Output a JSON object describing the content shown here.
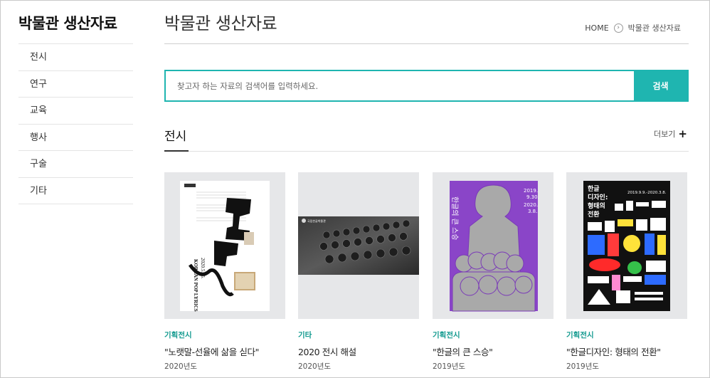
{
  "sidebar": {
    "title": "박물관 생산자료",
    "items": [
      {
        "label": "전시"
      },
      {
        "label": "연구"
      },
      {
        "label": "교육"
      },
      {
        "label": "행사"
      },
      {
        "label": "구술"
      },
      {
        "label": "기타"
      }
    ]
  },
  "header": {
    "title": "박물관 생산자료",
    "breadcrumb": {
      "home": "HOME",
      "current": "박물관 생산자료"
    }
  },
  "search": {
    "placeholder": "찾고자 하는 자료의 검색어를 입력하세요.",
    "value": "",
    "button_label": "검색"
  },
  "section": {
    "title": "전시",
    "more_label": "더보기",
    "more_icon": "plus-icon"
  },
  "cards": [
    {
      "category": "기획전시",
      "title": "\"노랫말-선율에 삶을 싣다\"",
      "year": "2020년도",
      "thumb_texts": [
        "KOREAN POP LYRICS",
        "2020.5.15."
      ]
    },
    {
      "category": "기타",
      "title": "2020 전시 해설",
      "year": "2020년도",
      "thumb_texts": [
        "국립한글박물관"
      ]
    },
    {
      "category": "기획전시",
      "title": "\"한글의 큰 스승\"",
      "year": "2019년도",
      "thumb_texts": [
        "2019.",
        "9.30.",
        "2020.",
        "3.8.",
        "한글의 큰 스승"
      ]
    },
    {
      "category": "기획전시",
      "title": "\"한글디자인: 형태의 전환\"",
      "year": "2019년도",
      "thumb_texts": [
        "한글",
        "디자인:",
        "형태의",
        "전환",
        "2019.9.9.-2020.3.8."
      ]
    }
  ],
  "colors": {
    "accent": "#1fb5b0",
    "category": "#139a8f",
    "poster_purple": "#8a45c8",
    "poster_black": "#111111"
  }
}
